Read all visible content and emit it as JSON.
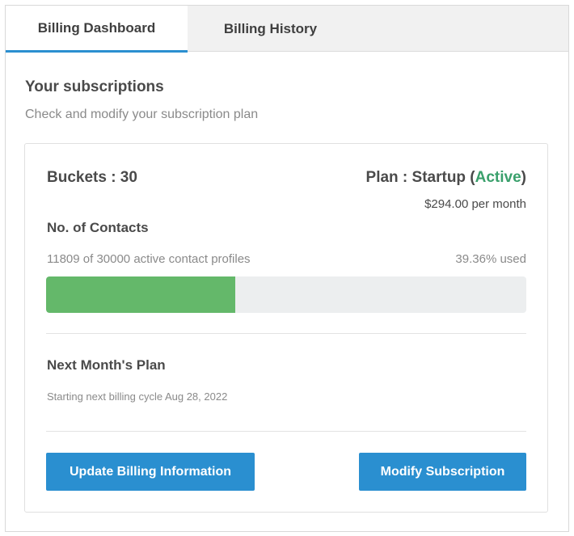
{
  "tabs": [
    {
      "label": "Billing Dashboard",
      "active": true
    },
    {
      "label": "Billing History",
      "active": false
    }
  ],
  "section": {
    "title": "Your subscriptions",
    "subtitle": "Check and modify your subscription plan"
  },
  "subscription": {
    "buckets_label": "Buckets : 30",
    "plan_prefix": "Plan : Startup (",
    "plan_status": "Active",
    "plan_suffix": ")",
    "price": "$294.00 per month",
    "contacts_title": "No. of Contacts",
    "contacts_detail": "11809 of 30000 active contact profiles",
    "usage_label": "39.36% used",
    "usage_fraction": 0.3936
  },
  "next_plan": {
    "title": "Next Month's Plan",
    "detail": "Starting next billing cycle Aug 28, 2022"
  },
  "actions": {
    "update_label": "Update Billing Information",
    "modify_label": "Modify Subscription"
  },
  "colors": {
    "accent": "#2a8fd0",
    "progress_fill": "#64b86a",
    "active_status": "#3aa06c"
  }
}
